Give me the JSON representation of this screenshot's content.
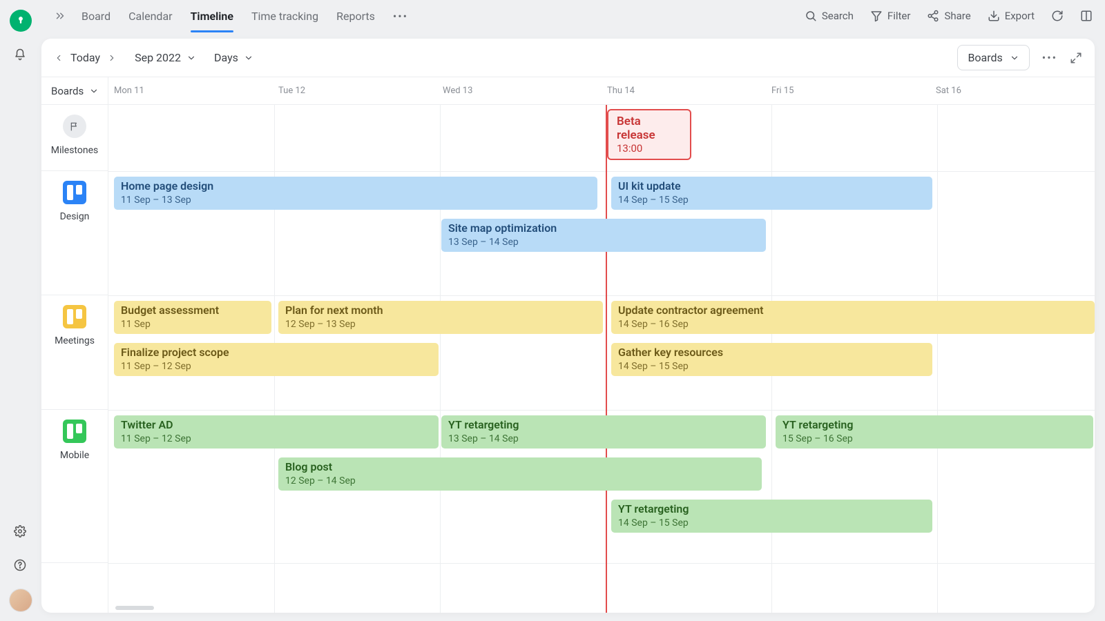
{
  "nav": {
    "tabs": [
      "Board",
      "Calendar",
      "Timeline",
      "Time tracking",
      "Reports"
    ],
    "active_index": 2
  },
  "topActions": {
    "search": "Search",
    "filter": "Filter",
    "share": "Share",
    "export": "Export"
  },
  "toolbar": {
    "today": "Today",
    "month": "Sep 2022",
    "granularity": "Days",
    "boards_btn": "Boards"
  },
  "sidebar_grouping_label": "Boards",
  "rows": {
    "milestones": "Milestones",
    "design": "Design",
    "meetings": "Meetings",
    "mobile": "Mobile"
  },
  "days": [
    "Mon 11",
    "Tue 12",
    "Wed 13",
    "Thu 14",
    "Fri 15",
    "Sat 16"
  ],
  "milestone": {
    "title": "Beta release",
    "time": "13:00"
  },
  "tasks": {
    "design": [
      {
        "title": "Home page design",
        "dates": "11 Sep – 13 Sep"
      },
      {
        "title": "Site map optimization",
        "dates": "13 Sep – 14 Sep"
      },
      {
        "title": "UI kit update",
        "dates": "14 Sep – 15 Sep"
      }
    ],
    "meetings": [
      {
        "title": "Budget assessment",
        "dates": "11 Sep"
      },
      {
        "title": "Plan for next month",
        "dates": "12 Sep – 13 Sep"
      },
      {
        "title": "Update contractor agreement",
        "dates": "14 Sep – 16 Sep"
      },
      {
        "title": "Finalize project scope",
        "dates": "11 Sep – 12 Sep"
      },
      {
        "title": "Gather key resources",
        "dates": "14 Sep – 15 Sep"
      }
    ],
    "mobile": [
      {
        "title": "Twitter AD",
        "dates": "11 Sep – 12 Sep"
      },
      {
        "title": "YT retargeting",
        "dates": "13 Sep – 14 Sep"
      },
      {
        "title": "YT retargeting",
        "dates": "15 Sep – 16 Sep"
      },
      {
        "title": "Blog post",
        "dates": "12 Sep – 14 Sep"
      },
      {
        "title": "YT retargeting",
        "dates": "14 Sep – 15 Sep"
      }
    ]
  }
}
